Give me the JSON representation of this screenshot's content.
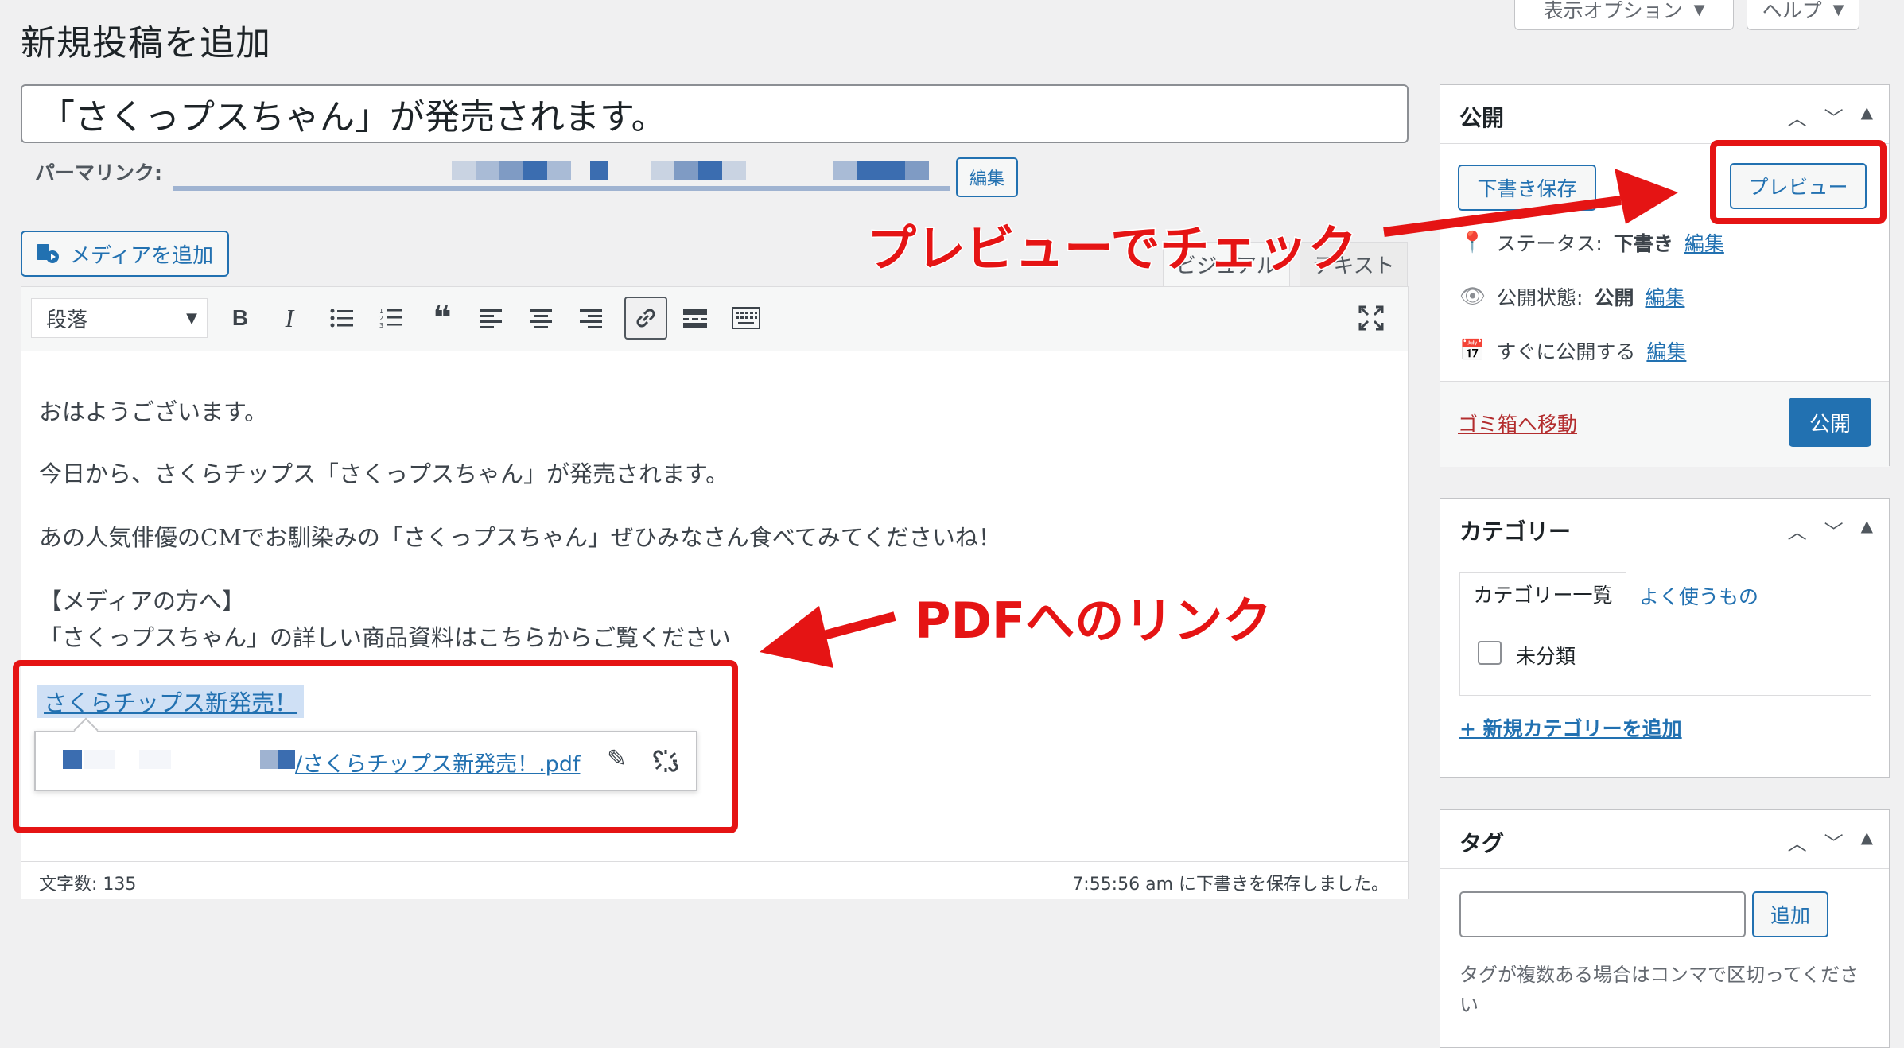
{
  "top_buttons": {
    "screen_options": "表示オプション",
    "help": "ヘルプ"
  },
  "page_title": "新規投稿を追加",
  "post_title": "「さくっプスちゃん」が発売されます。",
  "permalink": {
    "label": "パーマリンク:",
    "edit": "編集"
  },
  "media_button": "メディアを追加",
  "editor_tabs": {
    "visual": "ビジュアル",
    "text": "テキスト"
  },
  "toolbar": {
    "format": "段落"
  },
  "content": {
    "p1": "おはようございます。",
    "p2": "今日から、さくらチップス「さくっプスちゃん」が発売されます。",
    "p3": "あの人気俳優のCMでお馴染みの「さくっプスちゃん」ぜひみなさん食べてみてくださいね！",
    "p4": "【メディアの方へ】",
    "p5": "「さくっプスちゃん」の詳しい商品資料はこちらからご覧ください",
    "link_text": "さくらチップス新発売！",
    "link_url": "/さくらチップス新発売！.pdf"
  },
  "status": {
    "word_count": "文字数: 135",
    "saved": "7:55:56 am に下書きを保存しました。"
  },
  "publish_box": {
    "title": "公開",
    "save_draft": "下書き保存",
    "preview": "プレビュー",
    "status_label": "ステータス:",
    "status_value": "下書き",
    "visibility_label": "公開状態:",
    "visibility_value": "公開",
    "schedule": "すぐに公開する",
    "edit": "編集",
    "trash": "ゴミ箱へ移動",
    "publish": "公開"
  },
  "category_box": {
    "title": "カテゴリー",
    "tab_all": "カテゴリー一覧",
    "tab_popular": "よく使うもの",
    "item": "未分類",
    "add_new": "+ 新規カテゴリーを追加"
  },
  "tag_box": {
    "title": "タグ",
    "add": "追加",
    "hint": "タグが複数ある場合はコンマで区切ってください"
  },
  "annotations": {
    "preview_check": "プレビューでチェック",
    "pdf_link": "PDFへのリンク"
  },
  "colors": {
    "accent": "#2271b1",
    "annotation": "#e51414",
    "publish_button": "#2271b1"
  }
}
